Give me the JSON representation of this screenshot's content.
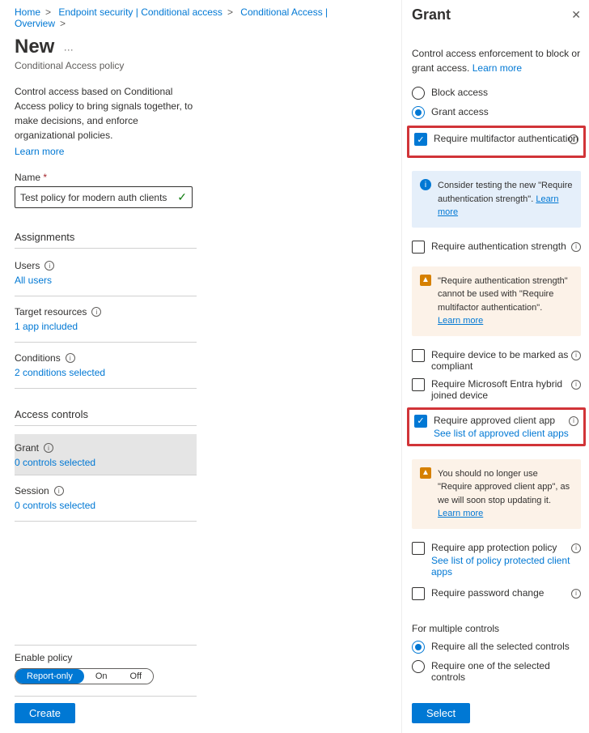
{
  "breadcrumb": [
    "Home",
    "Endpoint security | Conditional access",
    "Conditional Access | Overview"
  ],
  "page": {
    "title": "New",
    "subtitle": "Conditional Access policy",
    "description": "Control access based on Conditional Access policy to bring signals together, to make decisions, and enforce organizational policies.",
    "learn_more": "Learn more",
    "name_label": "Name",
    "name_value": "Test policy for modern auth clients",
    "assignments": "Assignments",
    "users": "Users",
    "users_link": "All users",
    "target": "Target resources",
    "target_link": "1 app included",
    "conditions": "Conditions",
    "conditions_link": "2 conditions selected",
    "access_controls": "Access controls",
    "grant": "Grant",
    "grant_link": "0 controls selected",
    "session": "Session",
    "session_link": "0 controls selected",
    "enable_label": "Enable policy",
    "toggle": {
      "report": "Report-only",
      "on": "On",
      "off": "Off"
    },
    "create": "Create"
  },
  "panel": {
    "title": "Grant",
    "desc_a": "Control access enforcement to block or grant access.",
    "learn_more": "Learn more",
    "block": "Block access",
    "grant": "Grant access",
    "mfa": "Require multifactor authentication",
    "callout1": "Consider testing the new \"Require authentication strength\".",
    "auth_strength": "Require authentication strength",
    "callout2": "\"Require authentication strength\" cannot be used with \"Require multifactor authentication\".",
    "compliant": "Require device to be marked as compliant",
    "hybrid": "Require Microsoft Entra hybrid joined device",
    "approved": "Require approved client app",
    "approved_link": "See list of approved client apps",
    "callout3": "You should no longer use \"Require approved client app\", as we will soon stop updating it.",
    "app_protect": "Require app protection policy",
    "app_protect_link": "See list of policy protected client apps",
    "pwd_change": "Require password change",
    "multi_label": "For multiple controls",
    "multi_all": "Require all the selected controls",
    "multi_one": "Require one of the selected controls",
    "select": "Select"
  }
}
